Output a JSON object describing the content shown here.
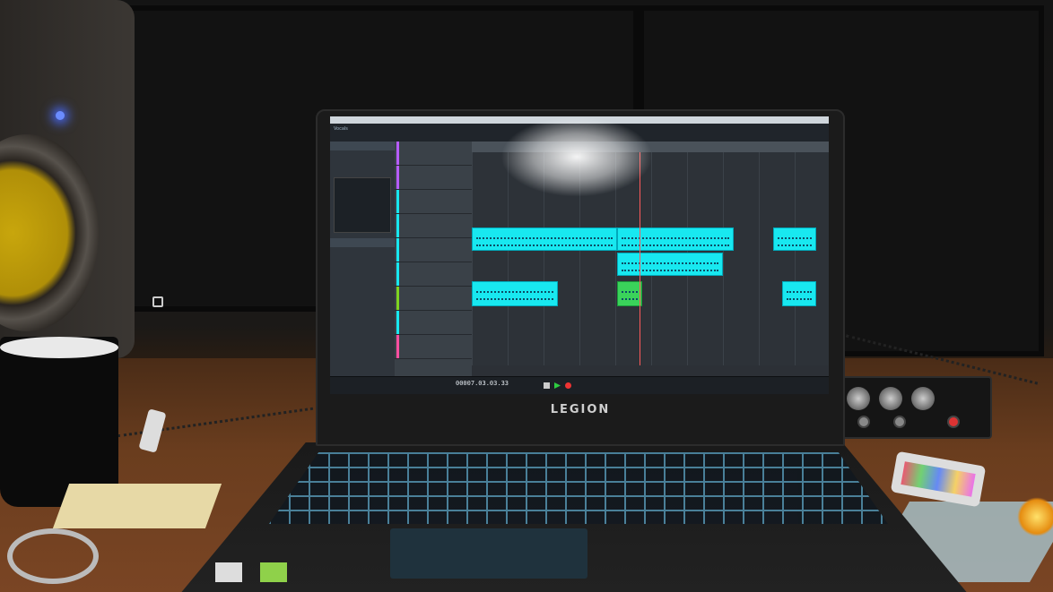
{
  "laptop": {
    "brand": "LEGION"
  },
  "daw": {
    "inspector_title": "Vocals",
    "time_display": "00007.03.03.33",
    "clips": [
      {
        "track": 3,
        "color": "#18e8f0"
      },
      {
        "track": 4,
        "color": "#18e8f0"
      },
      {
        "track": 6,
        "color": "#18e8f0"
      },
      {
        "track": 6,
        "color": "#3ad35a"
      }
    ]
  },
  "colors": {
    "clip_cyan": "#18e8f0",
    "clip_green": "#3ad35a",
    "keyboard_backlight": "#6fd1ff"
  }
}
